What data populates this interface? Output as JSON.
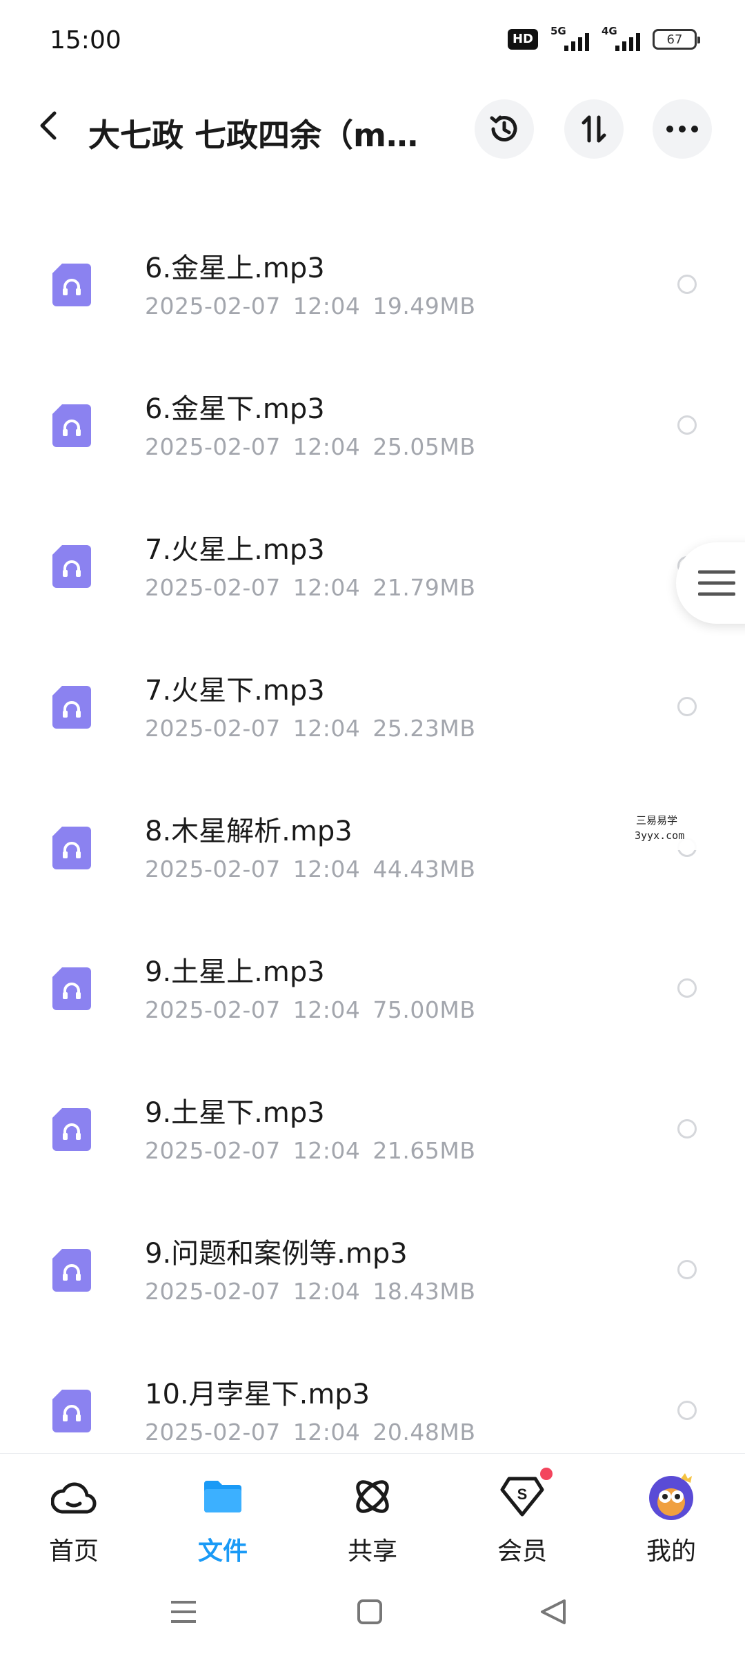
{
  "status_bar": {
    "time": "15:00",
    "hd_label": "HD",
    "net1": "5G",
    "net2": "4G",
    "battery": "67"
  },
  "header": {
    "title": "大七政 七政四余（m...",
    "icons": [
      "back-arrow-icon",
      "history-icon",
      "sort-icon",
      "more-icon"
    ]
  },
  "files": [
    {
      "name": "6.金星上.mp3",
      "date": "2025-02-07",
      "time": "12:04",
      "size": "19.49MB"
    },
    {
      "name": "6.金星下.mp3",
      "date": "2025-02-07",
      "time": "12:04",
      "size": "25.05MB"
    },
    {
      "name": "7.火星上.mp3",
      "date": "2025-02-07",
      "time": "12:04",
      "size": "21.79MB"
    },
    {
      "name": "7.火星下.mp3",
      "date": "2025-02-07",
      "time": "12:04",
      "size": "25.23MB"
    },
    {
      "name": "8.木星解析.mp3",
      "date": "2025-02-07",
      "time": "12:04",
      "size": "44.43MB"
    },
    {
      "name": "9.土星上.mp3",
      "date": "2025-02-07",
      "time": "12:04",
      "size": "75.00MB"
    },
    {
      "name": "9.土星下.mp3",
      "date": "2025-02-07",
      "time": "12:04",
      "size": "21.65MB"
    },
    {
      "name": "9.问题和案例等.mp3",
      "date": "2025-02-07",
      "time": "12:04",
      "size": "18.43MB"
    },
    {
      "name": "10.月孛星下.mp3",
      "date": "2025-02-07",
      "time": "12:04",
      "size": "20.48MB"
    }
  ],
  "watermark": {
    "line1": "三易易学",
    "line2": "3yyx.com"
  },
  "bottom_nav": [
    {
      "label": "首页",
      "icon": "home-cloud-icon",
      "active": false
    },
    {
      "label": "文件",
      "icon": "folder-icon",
      "active": true
    },
    {
      "label": "共享",
      "icon": "share-atom-icon",
      "active": false
    },
    {
      "label": "会员",
      "icon": "vip-diamond-icon",
      "active": false,
      "badge": true
    },
    {
      "label": "我的",
      "icon": "avatar-icon",
      "active": false
    }
  ],
  "colors": {
    "accent": "#1a9af6",
    "file_icon": "#8b82f0",
    "meta_text": "#a3a6ad",
    "badge": "#f3455d"
  }
}
